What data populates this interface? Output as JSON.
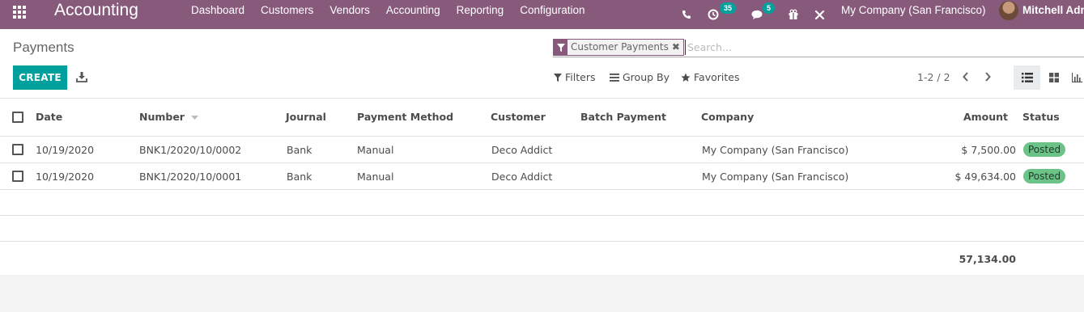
{
  "navbar": {
    "app_title": "Accounting",
    "menu": [
      "Dashboard",
      "Customers",
      "Vendors",
      "Accounting",
      "Reporting",
      "Configuration"
    ],
    "activity_count": "35",
    "message_count": "5",
    "company": "My Company (San Francisco)",
    "user": "Mitchell Admin",
    "icons": [
      "apps-grid-icon",
      "phone-icon",
      "activity-clock-icon",
      "chat-icon",
      "gift-icon",
      "tools-icon"
    ],
    "colors": {
      "bar": "#875a7b",
      "badge": "#00a09d"
    }
  },
  "control_panel": {
    "title": "Payments",
    "search": {
      "facet_label": "Customer Payments",
      "facet_close": "✖",
      "placeholder": "Search..."
    },
    "create_label": "CREATE",
    "filters_label": "Filters",
    "groupby_label": "Group By",
    "favorites_label": "Favorites",
    "pager": "1-2 / 2",
    "colors": {
      "create": "#00a09d"
    }
  },
  "table": {
    "columns": {
      "date": "Date",
      "number": "Number",
      "journal": "Journal",
      "payment_method": "Payment Method",
      "customer": "Customer",
      "batch_payment": "Batch Payment",
      "company": "Company",
      "amount": "Amount",
      "status": "Status"
    },
    "rows": [
      {
        "date": "10/19/2020",
        "number": "BNK1/2020/10/0002",
        "journal": "Bank",
        "payment_method": "Manual",
        "customer": "Deco Addict",
        "batch_payment": "",
        "company": "My Company (San Francisco)",
        "amount": "$ 7,500.00",
        "status": "Posted"
      },
      {
        "date": "10/19/2020",
        "number": "BNK1/2020/10/0001",
        "journal": "Bank",
        "payment_method": "Manual",
        "customer": "Deco Addict",
        "batch_payment": "",
        "company": "My Company (San Francisco)",
        "amount": "$ 49,634.00",
        "status": "Posted"
      }
    ],
    "total": "57,134.00",
    "colors": {
      "posted_badge": "#6cc387"
    }
  }
}
